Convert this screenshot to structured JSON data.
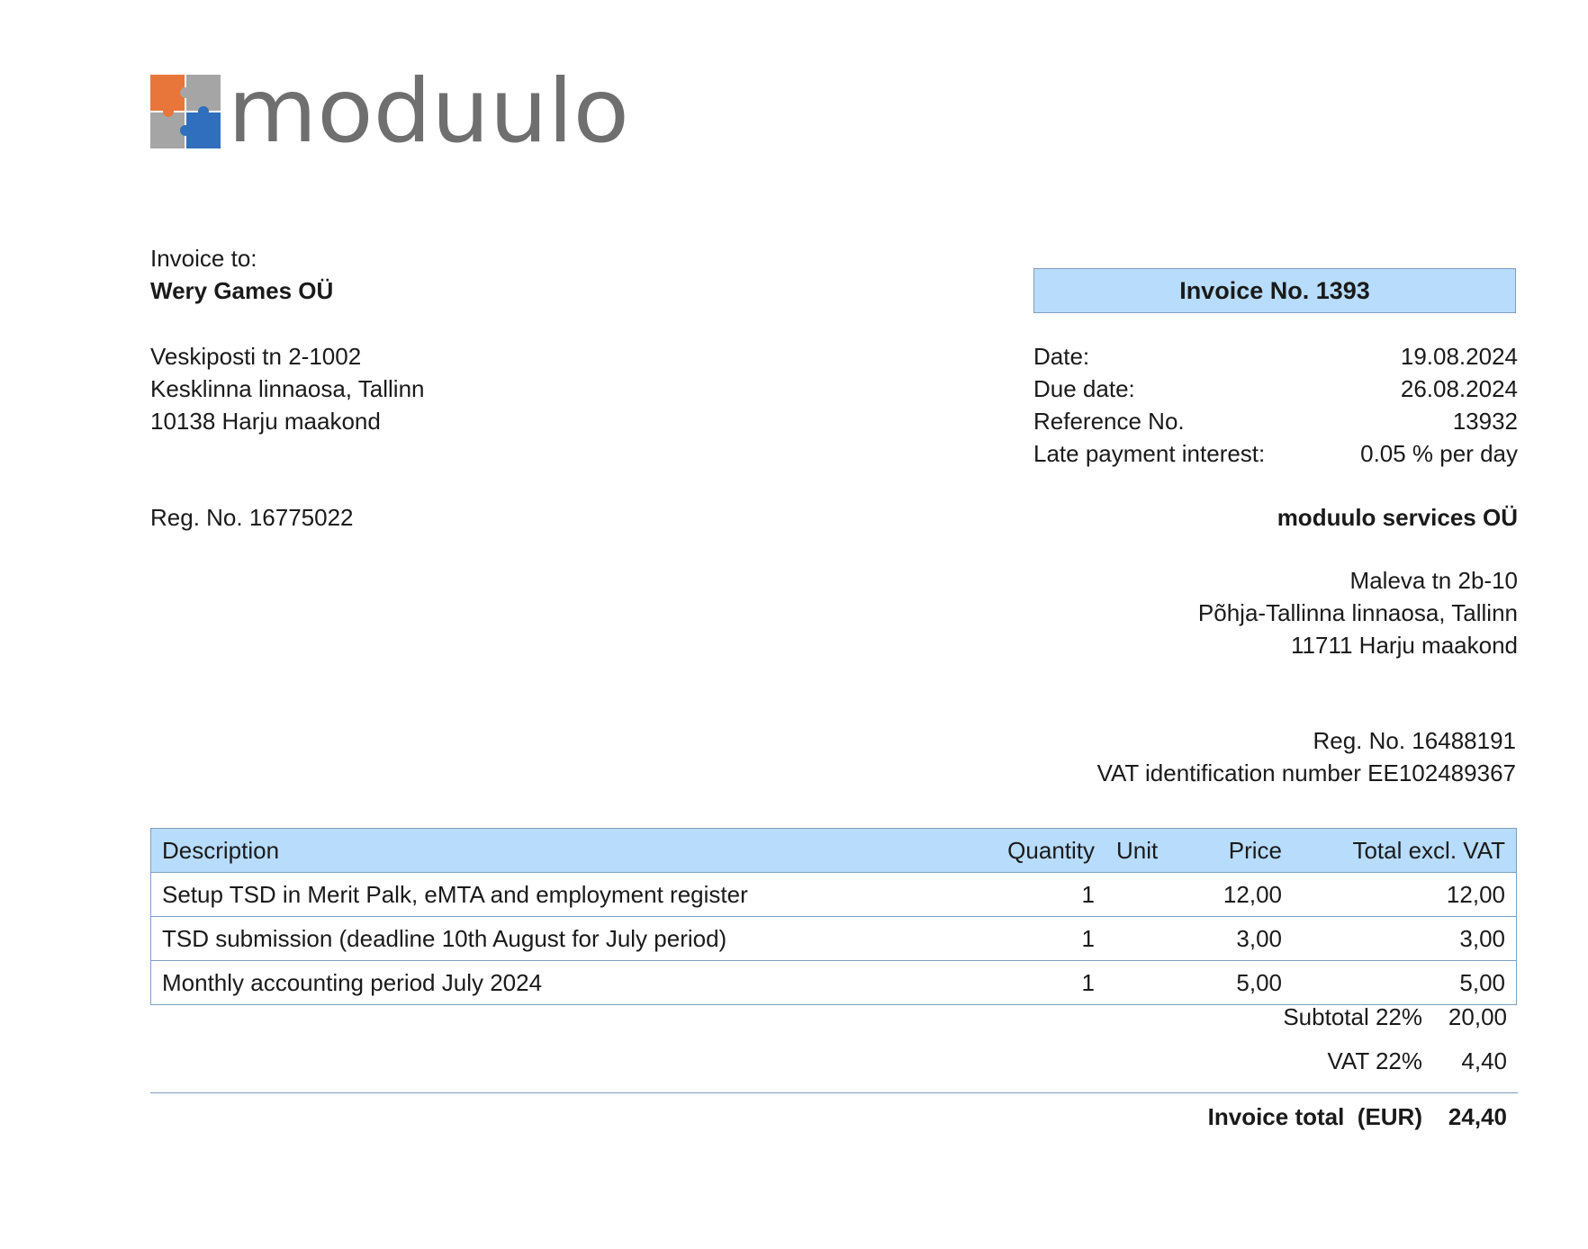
{
  "logo": {
    "text": "moduulo",
    "colors": {
      "orange": "#e8763a",
      "gray": "#a5a5a5",
      "blue": "#2f6fbd",
      "text": "#6f6f6f"
    }
  },
  "buyer": {
    "label": "Invoice to:",
    "name": "Wery Games OÜ",
    "address": [
      "Veskiposti tn 2-1002",
      "Kesklinna linnaosa, Tallinn",
      "10138 Harju maakond"
    ],
    "reg": "Reg. No. 16775022"
  },
  "invoice": {
    "title": "Invoice No. 1393",
    "meta": [
      {
        "label": "Date:",
        "value": "19.08.2024"
      },
      {
        "label": "Due date:",
        "value": "26.08.2024"
      },
      {
        "label": "Reference No.",
        "value": "13932"
      },
      {
        "label": "Late payment interest:",
        "value": "0.05 % per day"
      }
    ]
  },
  "seller": {
    "name": "moduulo services OÜ",
    "address": [
      "Maleva tn 2b-10",
      "Põhja-Tallinna linnaosa, Tallinn",
      "11711 Harju maakond"
    ],
    "reg": "Reg. No. 16488191",
    "vat": "VAT identification number EE102489367"
  },
  "table": {
    "headers": {
      "description": "Description",
      "quantity": "Quantity",
      "unit": "Unit",
      "price": "Price",
      "total": "Total excl. VAT"
    },
    "rows": [
      {
        "description": "Setup TSD in Merit Palk, eMTA and employment register",
        "quantity": "1",
        "unit": "",
        "price": "12,00",
        "total": "12,00"
      },
      {
        "description": "TSD submission (deadline 10th August for July period)",
        "quantity": "1",
        "unit": "",
        "price": "3,00",
        "total": "3,00"
      },
      {
        "description": "Monthly accounting period July 2024",
        "quantity": "1",
        "unit": "",
        "price": "5,00",
        "total": "5,00"
      }
    ]
  },
  "totals": {
    "subtotal_label": "Subtotal 22%",
    "subtotal_value": "20,00",
    "vat_label": "VAT 22%",
    "vat_value": "4,40",
    "total_label": "Invoice total  (EUR)",
    "total_value": "24,40"
  },
  "colors": {
    "header_fill": "#b8dcfb",
    "border": "#7f9fbf"
  }
}
